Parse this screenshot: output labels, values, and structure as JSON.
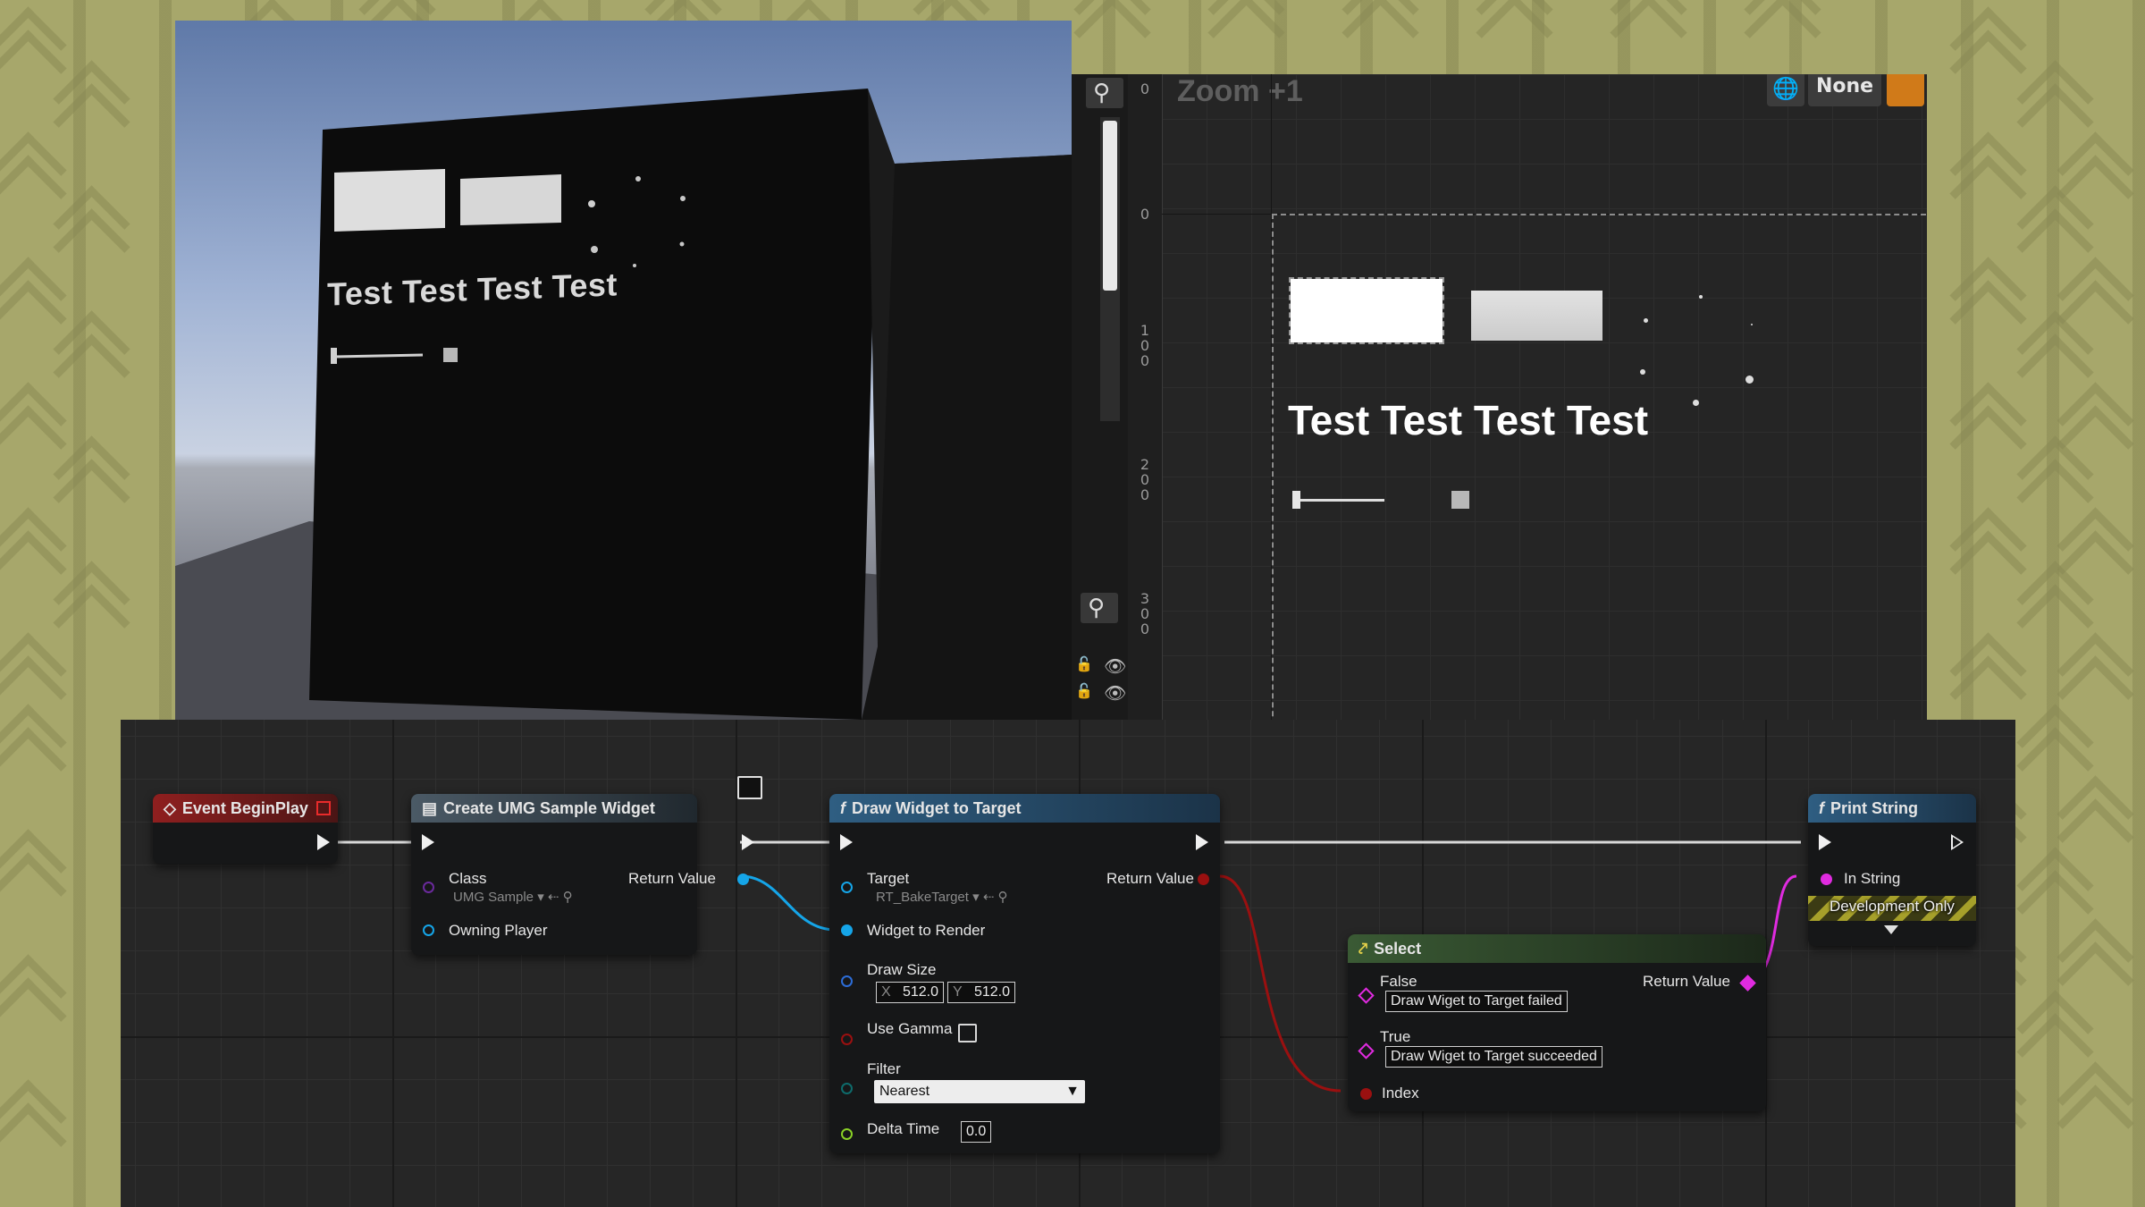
{
  "viewport": {
    "overlay_text": "Test Test Test Test"
  },
  "designer": {
    "zoom_label": "Zoom +1",
    "none_label": "None",
    "ruler_labels": [
      "0",
      "0",
      "1",
      "0",
      "0",
      "2",
      "0",
      "0",
      "3",
      "0",
      "0"
    ],
    "widget_text": "Test Test Test Test",
    "icons": [
      "search-icon",
      "eye-icon",
      "lock-icon",
      "globe-icon"
    ]
  },
  "graph": {
    "event_begin_play": {
      "title": "Event BeginPlay"
    },
    "create_widget": {
      "title": "Create UMG Sample Widget",
      "class_label": "Class",
      "class_value": "UMG Sample",
      "return_label": "Return Value",
      "owning_label": "Owning Player"
    },
    "draw_widget": {
      "title": "Draw Widget to Target",
      "target_label": "Target",
      "target_value": "RT_BakeTarget",
      "return_label": "Return Value",
      "widget_label": "Widget to Render",
      "drawsize_label": "Draw Size",
      "x_label": "X",
      "x_value": "512.0",
      "y_label": "Y",
      "y_value": "512.0",
      "gamma_label": "Use Gamma",
      "filter_label": "Filter",
      "filter_value": "Nearest",
      "delta_label": "Delta Time",
      "delta_value": "0.0"
    },
    "select": {
      "title": "Select",
      "false_label": "False",
      "false_value": "Draw Wiget to Target failed",
      "true_label": "True",
      "true_value": "Draw Wiget to Target succeeded",
      "index_label": "Index",
      "return_label": "Return Value"
    },
    "print_string": {
      "title": "Print String",
      "in_string_label": "In String",
      "dev_only_label": "Development Only"
    }
  },
  "colors": {
    "event_header": "#8f1f1f",
    "function_header": "#2f5e82",
    "select_header": "#3a5a34",
    "exec": "#f0f0f0",
    "object_pin": "#15a5e8",
    "bool_pin": "#9a1010",
    "string_pin": "#e02be0",
    "float_pin": "#8ad126",
    "class_pin": "#6a2a9c",
    "struct_pin": "#2c6cd6",
    "byte_pin": "#0e6b6b"
  }
}
